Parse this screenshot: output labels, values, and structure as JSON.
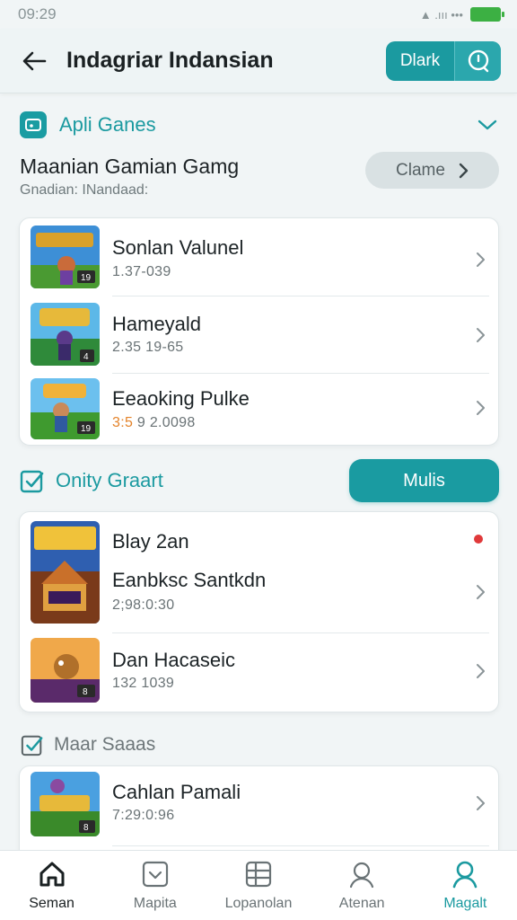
{
  "status_bar": {
    "time": "09:29",
    "signal_text": "▲ .ııı •••"
  },
  "header": {
    "title": "Indagriar Indansian",
    "dark_label": "Dlark"
  },
  "section1": {
    "title": "Apli Ganes",
    "subtitle": "Maanian Gamian Gamg",
    "caption": "Gnadian: INandaad:",
    "clame_label": "Clame"
  },
  "list1": [
    {
      "name": "Sonlan Valunel",
      "meta": "1.37-039",
      "thumb_badge": "19"
    },
    {
      "name": "Hameyald",
      "meta": "2.35 19-65",
      "thumb_badge": "4"
    },
    {
      "name": "Eeaoking Pulke",
      "meta_accent": "3:5",
      "meta": " 9 2.0098",
      "thumb_badge": "19"
    }
  ],
  "section2": {
    "title": "Onity Graart",
    "button_label": "Mulis"
  },
  "list2": [
    {
      "name": "Blay 2an",
      "name2": "Eanbksc Santkdn",
      "meta": "2;98:0:30"
    },
    {
      "name": "Dan Hacaseic",
      "meta": "132 1039",
      "thumb_badge": "8"
    }
  ],
  "section3": {
    "title": "Maar Saaas"
  },
  "list3": [
    {
      "name": "Cahlan Pamali",
      "meta": "7:29:0:96",
      "thumb_badge": "8"
    }
  ],
  "nav": [
    {
      "label": "Seman",
      "icon": "home-icon"
    },
    {
      "label": "Mapita",
      "icon": "inbox-icon"
    },
    {
      "label": "Lopanolan",
      "icon": "grid-list-icon"
    },
    {
      "label": "Atenan",
      "icon": "people-icon"
    },
    {
      "label": "Magalt",
      "icon": "profile-icon"
    }
  ],
  "colors": {
    "accent": "#1b9aa0",
    "background": "#f1f5f6",
    "notification": "#e0393a"
  }
}
